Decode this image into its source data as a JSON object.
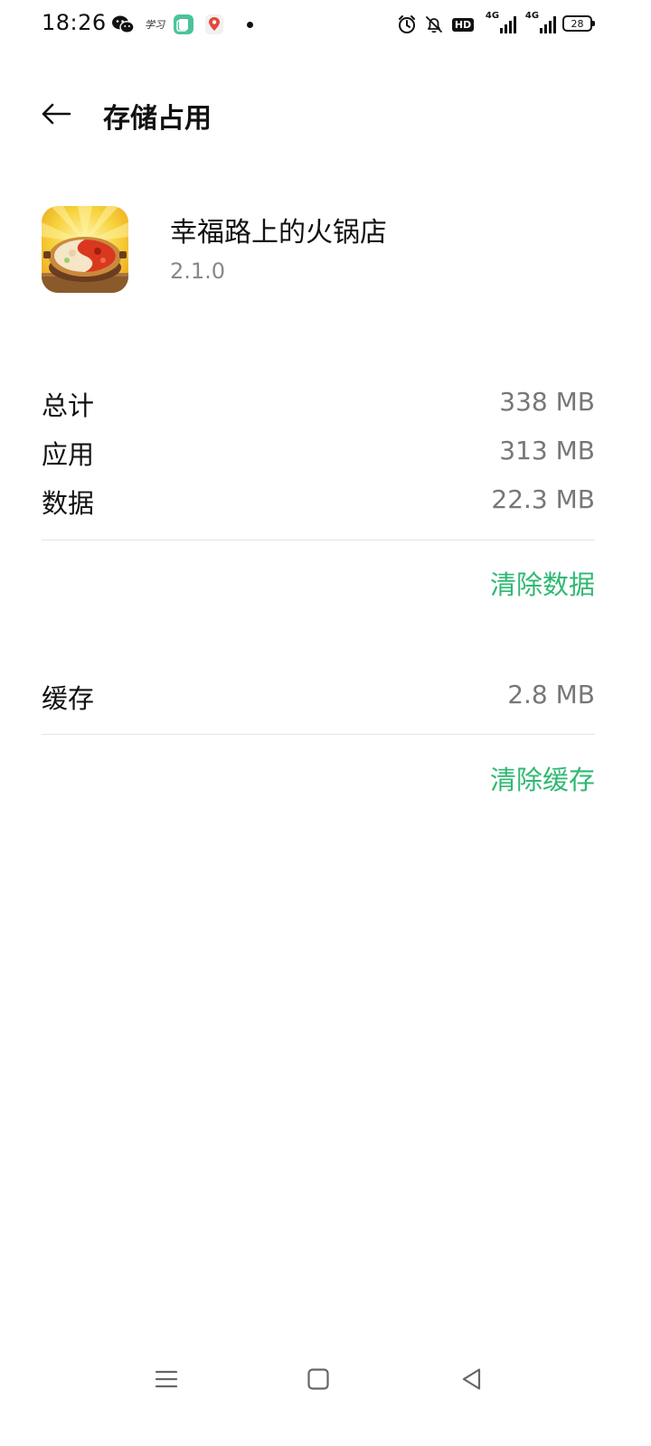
{
  "status_bar": {
    "time": "18:26",
    "notif_text": "学习",
    "net_label_1": "4G",
    "net_label_2": "4G",
    "hd": "HD",
    "battery": "28"
  },
  "header": {
    "title": "存储占用"
  },
  "app": {
    "name": "幸福路上的火锅店",
    "version": "2.1.0"
  },
  "storage": {
    "total_label": "总计",
    "total_value": "338 MB",
    "app_label": "应用",
    "app_value": "313 MB",
    "data_label": "数据",
    "data_value": "22.3 MB",
    "clear_data": "清除数据"
  },
  "cache": {
    "label": "缓存",
    "value": "2.8 MB",
    "clear_cache": "清除缓存"
  },
  "colors": {
    "accent": "#2fb873",
    "value_gray": "#777777",
    "divider": "#e3e3e3"
  }
}
